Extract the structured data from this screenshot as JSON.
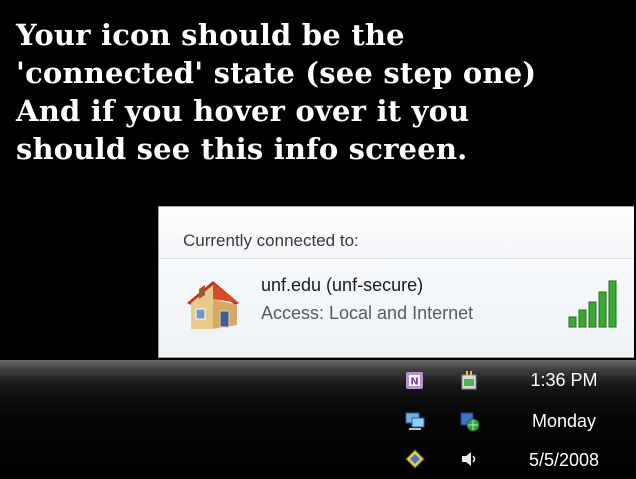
{
  "headline": {
    "line1": "Your icon should be the",
    "line2": "'connected' state (see step one)",
    "line3": "And if you hover over it you",
    "line4": "should see this info screen."
  },
  "popup": {
    "title": "Currently connected to:",
    "network_name": "unf.edu (unf-secure)",
    "access_text": "Access:  Local and Internet",
    "signal_icon": "signal-strength-icon",
    "network_icon": "home-network-icon"
  },
  "tray": {
    "icons": [
      "onenote-icon",
      "power-icon",
      "network-connected-icon",
      "network-globe-icon",
      "shield-icon",
      "volume-icon"
    ],
    "time": "1:36 PM",
    "day": "Monday",
    "date": "5/5/2008"
  },
  "colors": {
    "background": "#000000",
    "popup_border": "#9aa3ad",
    "signal_green": "#3ca832"
  }
}
